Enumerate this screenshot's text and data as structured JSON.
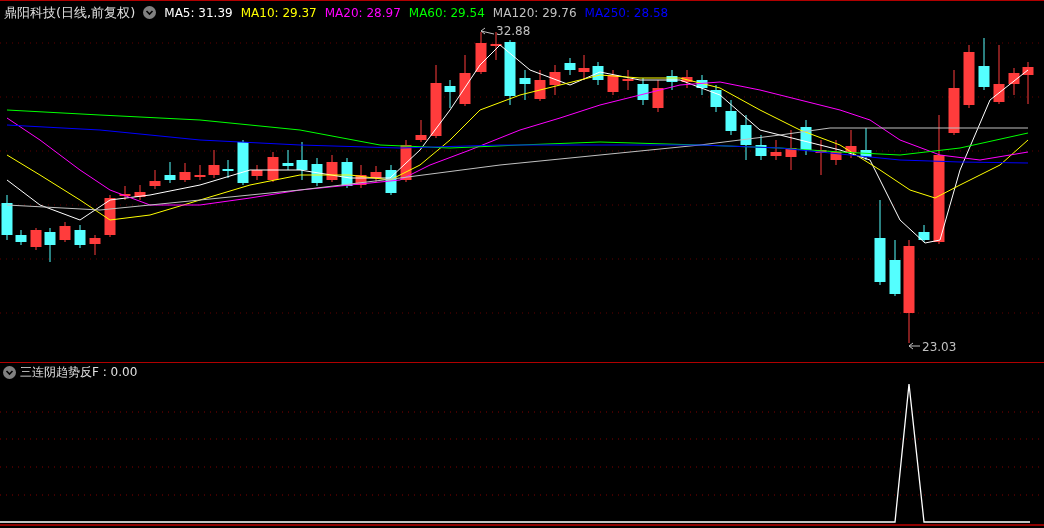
{
  "header": {
    "title": "鼎阳科技(日线,前复权)",
    "ma": [
      {
        "label": "MA5: 31.39",
        "color": "#ffffff"
      },
      {
        "label": "MA10: 29.37",
        "color": "#ffff00"
      },
      {
        "label": "MA20: 28.97",
        "color": "#ff00ff"
      },
      {
        "label": "MA60: 29.54",
        "color": "#00ff00"
      },
      {
        "label": "MA120: 29.76",
        "color": "#c0c0c0"
      },
      {
        "label": "MA250: 28.58",
        "color": "#0000ff"
      }
    ]
  },
  "main_chart": {
    "high_label": "32.88",
    "low_label": "23.03"
  },
  "indicator": {
    "label": "三连阴趋势反F : 0.00"
  }
}
